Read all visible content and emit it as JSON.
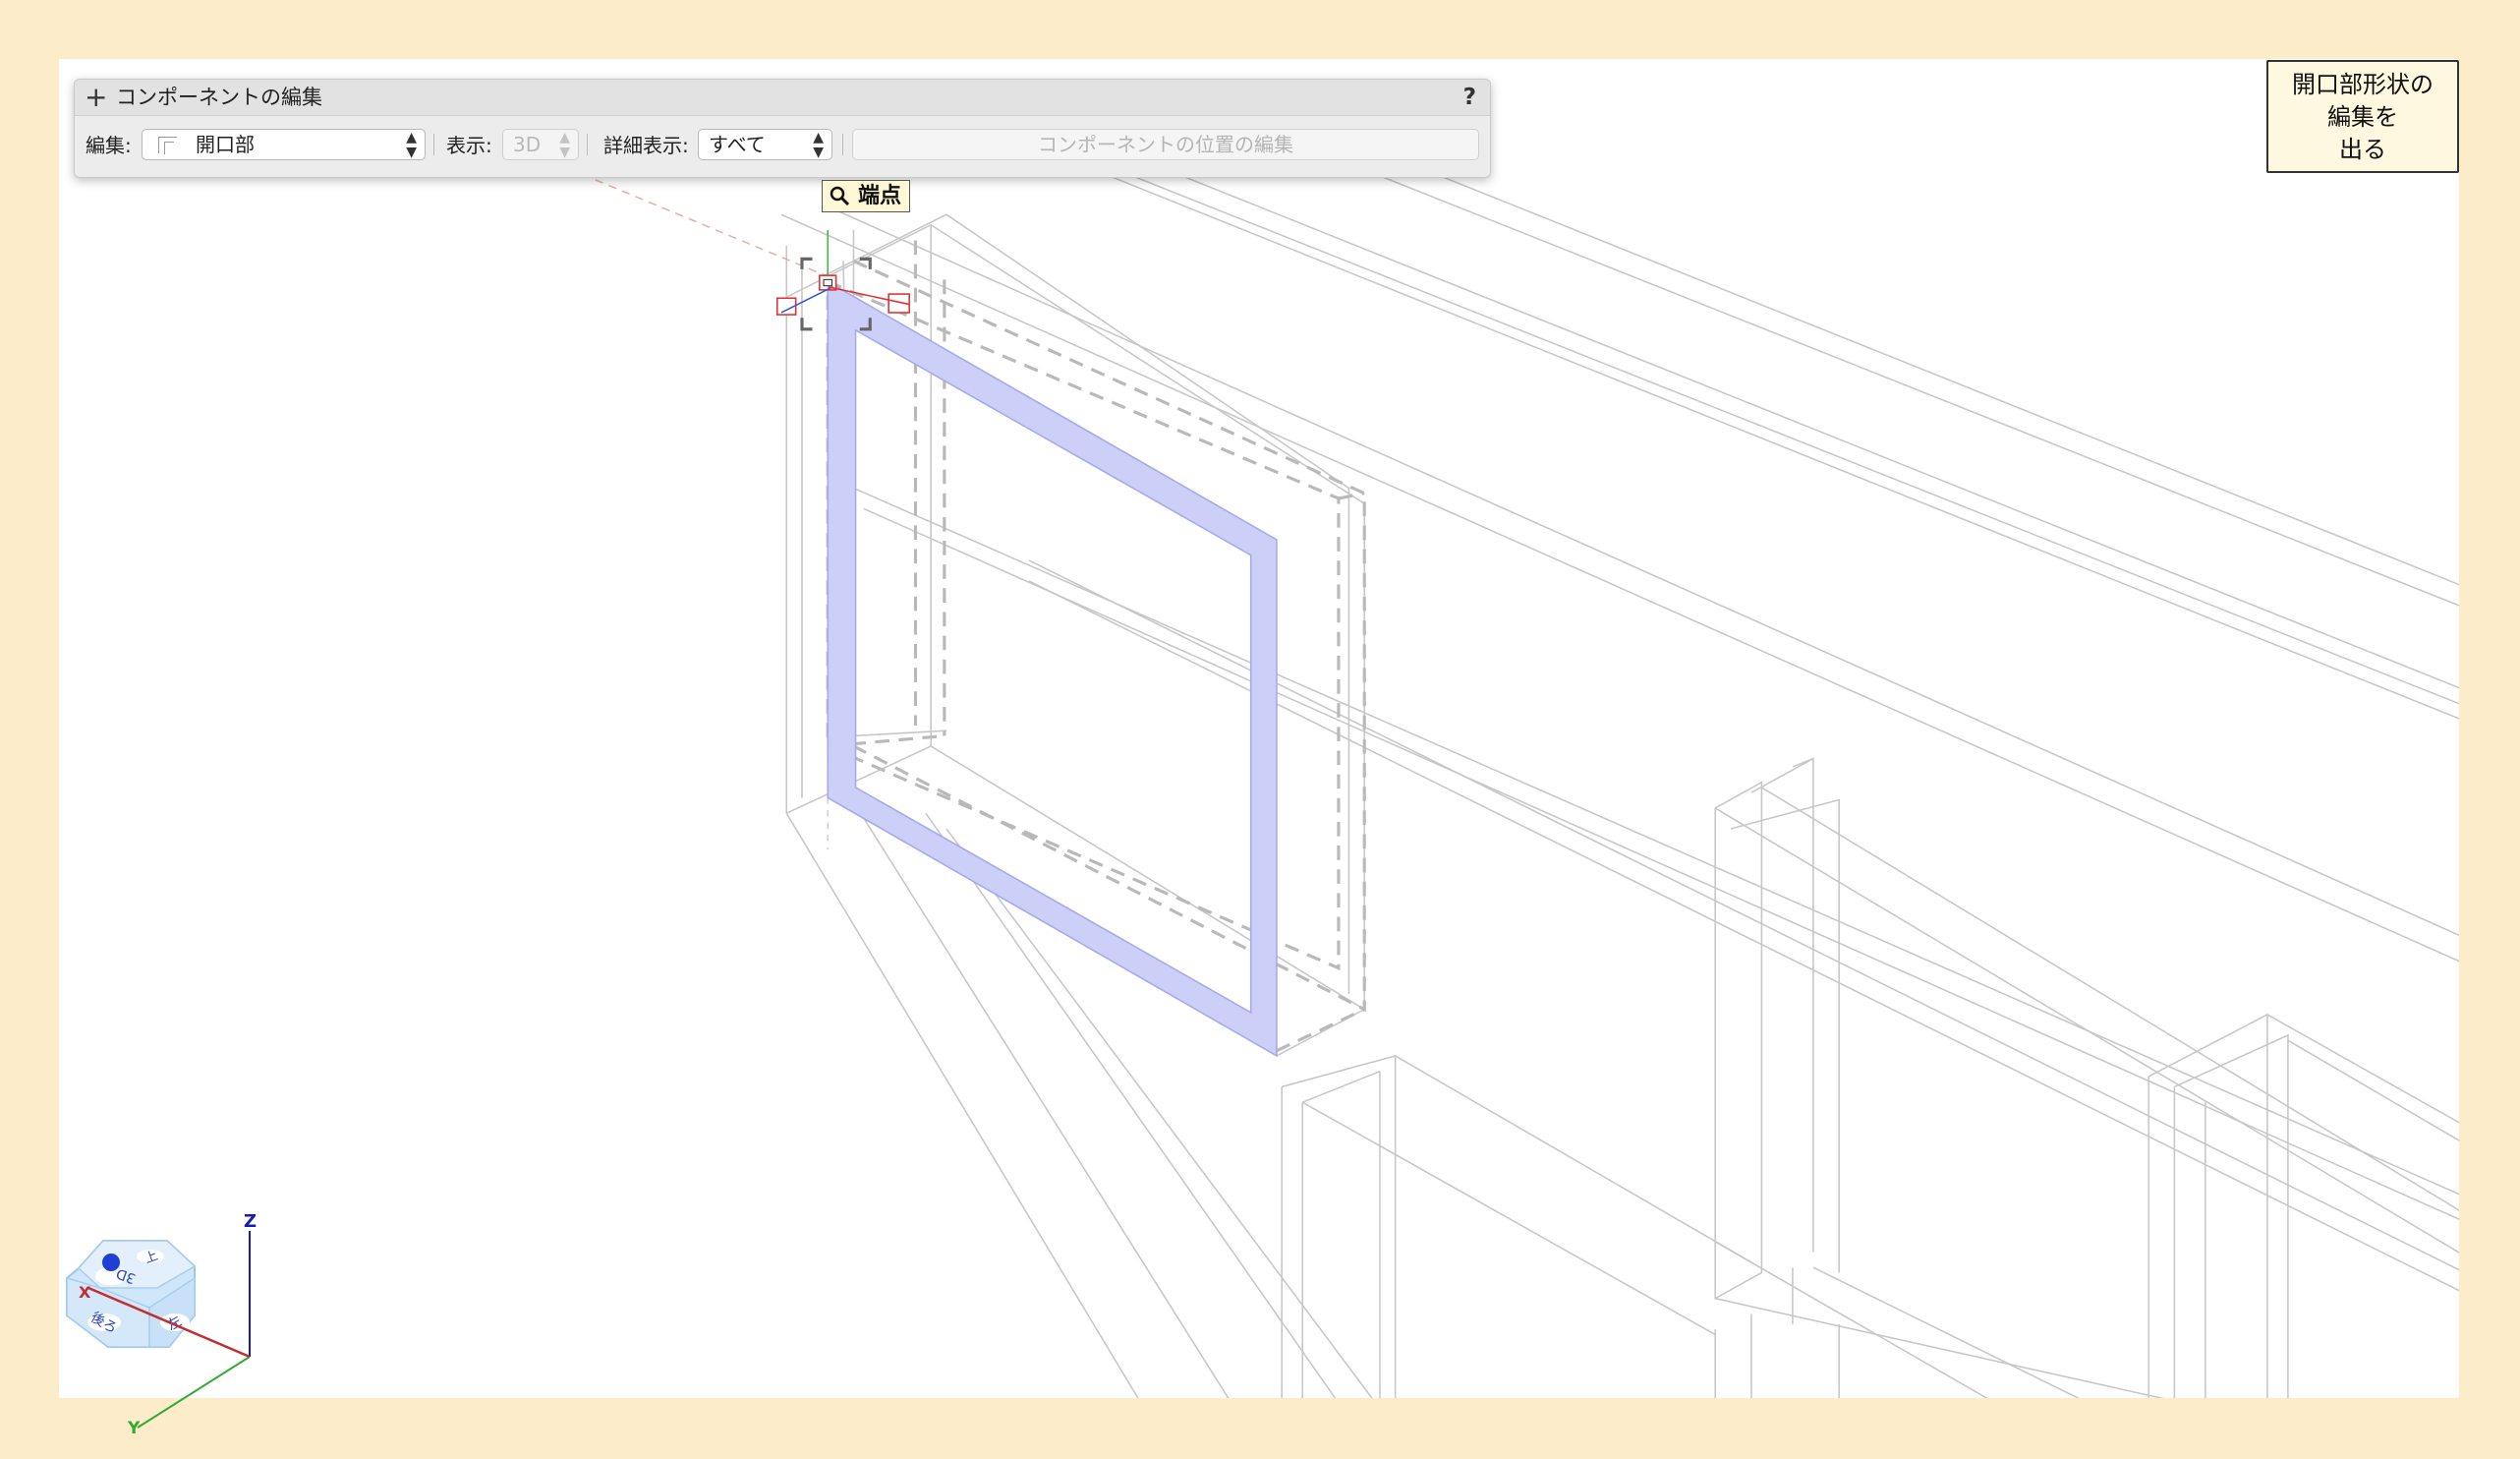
{
  "palette": {
    "title": "コンポーネントの編集",
    "help": "?",
    "edit_label": "編集:",
    "edit_value": "開口部",
    "display_label": "表示:",
    "display_value": "3D",
    "detail_label": "詳細表示:",
    "detail_value": "すべて",
    "edit_position_button": "コンポーネントの位置の編集"
  },
  "exit_button": {
    "label": "開口部形状の\n編集を\n出る"
  },
  "snap_tooltip": {
    "text": "端点"
  },
  "view_cube": {
    "faces": [
      "上",
      "3D",
      "後ろ",
      "左"
    ],
    "axes": {
      "x": "X",
      "y": "Y",
      "z": "Z"
    }
  },
  "colors": {
    "background": "#fcecca",
    "selection_fill": "#cccff7",
    "wire": "#c4c4c4"
  }
}
